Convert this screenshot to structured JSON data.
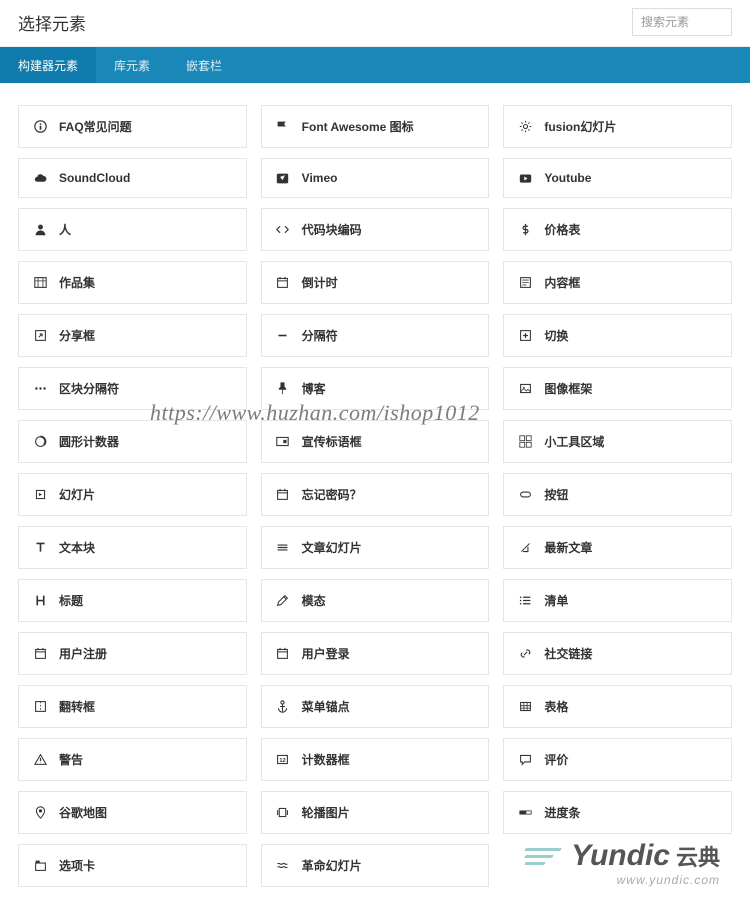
{
  "header": {
    "title": "选择元素",
    "search_placeholder": "搜索元素"
  },
  "tabs": [
    {
      "label": "构建器元素",
      "active": true
    },
    {
      "label": "库元素",
      "active": false
    },
    {
      "label": "嵌套栏",
      "active": false
    }
  ],
  "elements": [
    {
      "icon": "info",
      "label": "FAQ常见问题"
    },
    {
      "icon": "flag",
      "label": "Font Awesome 图标"
    },
    {
      "icon": "gear",
      "label": "fusion幻灯片"
    },
    {
      "icon": "cloud",
      "label": "SoundCloud"
    },
    {
      "icon": "vimeo",
      "label": "Vimeo"
    },
    {
      "icon": "youtube",
      "label": "Youtube"
    },
    {
      "icon": "person",
      "label": "人"
    },
    {
      "icon": "code",
      "label": "代码块编码"
    },
    {
      "icon": "dollar",
      "label": "价格表"
    },
    {
      "icon": "portfolio",
      "label": "作品集"
    },
    {
      "icon": "calendar",
      "label": "倒计时"
    },
    {
      "icon": "content-box",
      "label": "内容框"
    },
    {
      "icon": "share",
      "label": "分享框"
    },
    {
      "icon": "minus",
      "label": "分隔符"
    },
    {
      "icon": "toggle",
      "label": "切换"
    },
    {
      "icon": "dots",
      "label": "区块分隔符"
    },
    {
      "icon": "pushpin",
      "label": "博客"
    },
    {
      "icon": "image",
      "label": "图像框架"
    },
    {
      "icon": "counter",
      "label": "圆形计数器"
    },
    {
      "icon": "tagline",
      "label": "宣传标语框"
    },
    {
      "icon": "widget",
      "label": "小工具区域"
    },
    {
      "icon": "slides",
      "label": "幻灯片"
    },
    {
      "icon": "calendar",
      "label": "忘记密码？"
    },
    {
      "icon": "button",
      "label": "按钮"
    },
    {
      "icon": "text",
      "label": "文本块"
    },
    {
      "icon": "layers",
      "label": "文章幻灯片"
    },
    {
      "icon": "feather",
      "label": "最新文章"
    },
    {
      "icon": "heading",
      "label": "标题"
    },
    {
      "icon": "edit",
      "label": "模态"
    },
    {
      "icon": "list",
      "label": "清单"
    },
    {
      "icon": "calendar",
      "label": "用户注册"
    },
    {
      "icon": "calendar",
      "label": "用户登录"
    },
    {
      "icon": "link",
      "label": "社交链接"
    },
    {
      "icon": "flip",
      "label": "翻转框"
    },
    {
      "icon": "anchor",
      "label": "菜单锚点"
    },
    {
      "icon": "table",
      "label": "表格"
    },
    {
      "icon": "warning",
      "label": "警告"
    },
    {
      "icon": "counter-box",
      "label": "计数器框"
    },
    {
      "icon": "comment",
      "label": "评价"
    },
    {
      "icon": "map",
      "label": "谷歌地图"
    },
    {
      "icon": "carousel",
      "label": "轮播图片"
    },
    {
      "icon": "progress",
      "label": "进度条"
    },
    {
      "icon": "tab",
      "label": "选项卡"
    },
    {
      "icon": "wave",
      "label": "革命幻灯片"
    }
  ],
  "watermarks": {
    "url": "https://www.huzhan.com/ishop1012",
    "logo_name": "Yundic",
    "logo_cn": "云典",
    "logo_sub": "www.yundic.com"
  }
}
